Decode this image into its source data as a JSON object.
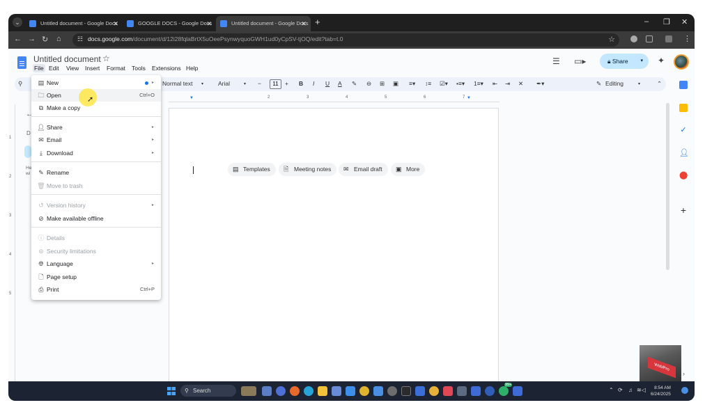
{
  "browser": {
    "tabs": [
      {
        "title": "Untitled document - Google Docs",
        "active": false
      },
      {
        "title": "GOOGLE DOCS - Google Docs",
        "active": false
      },
      {
        "title": "Untitled document - Google Docs",
        "active": true
      }
    ],
    "url_host": "docs.google.com",
    "url_path": "/document/d/12i28fqlaBrtX5uOeePsynwyquoGWH1ud0yCpSV-tjOQ/edit?tab=t.0"
  },
  "docs": {
    "title": "Untitled document",
    "menubar": [
      "File",
      "Edit",
      "View",
      "Insert",
      "Format",
      "Tools",
      "Extensions",
      "Help"
    ],
    "share_label": "Share",
    "toolbar": {
      "style": "Normal text",
      "font": "Arial",
      "font_size": "11",
      "mode": "Editing"
    },
    "ruler_numbers": [
      "1",
      "2",
      "3",
      "4",
      "5",
      "6",
      "7"
    ],
    "vruler_numbers": [
      "1",
      "2",
      "3",
      "4",
      "5"
    ],
    "chips": [
      {
        "label": "Templates",
        "icon": "templates-icon"
      },
      {
        "label": "Meeting notes",
        "icon": "meeting-notes-icon"
      },
      {
        "label": "Email draft",
        "icon": "email-draft-icon"
      },
      {
        "label": "More",
        "icon": "more-icon"
      }
    ],
    "outline_fragments": [
      "D",
      "He",
      "wi"
    ]
  },
  "file_menu": {
    "items": [
      {
        "label": "New",
        "icon": "new-doc-icon",
        "shortcut": "",
        "submenu": true,
        "disabled": false,
        "badge_dot": true
      },
      {
        "label": "Open",
        "icon": "folder-icon",
        "shortcut": "Ctrl+O",
        "submenu": false,
        "disabled": false,
        "hover": true
      },
      {
        "label": "Make a copy",
        "icon": "copy-icon",
        "shortcut": "",
        "submenu": false,
        "disabled": false
      },
      {
        "label": "Share",
        "icon": "share-person-icon",
        "shortcut": "",
        "submenu": true,
        "disabled": false
      },
      {
        "label": "Email",
        "icon": "email-icon",
        "shortcut": "",
        "submenu": true,
        "disabled": false
      },
      {
        "label": "Download",
        "icon": "download-icon",
        "shortcut": "",
        "submenu": true,
        "disabled": false
      },
      {
        "label": "Rename",
        "icon": "pencil-icon",
        "shortcut": "",
        "submenu": false,
        "disabled": false
      },
      {
        "label": "Move to trash",
        "icon": "trash-icon",
        "shortcut": "",
        "submenu": false,
        "disabled": true
      },
      {
        "label": "Version history",
        "icon": "history-icon",
        "shortcut": "",
        "submenu": true,
        "disabled": true
      },
      {
        "label": "Make available offline",
        "icon": "offline-icon",
        "shortcut": "",
        "submenu": false,
        "disabled": false
      },
      {
        "label": "Details",
        "icon": "info-icon",
        "shortcut": "",
        "submenu": false,
        "disabled": true
      },
      {
        "label": "Security limitations",
        "icon": "security-icon",
        "shortcut": "",
        "submenu": false,
        "disabled": true
      },
      {
        "label": "Language",
        "icon": "globe-icon",
        "shortcut": "",
        "submenu": true,
        "disabled": false
      },
      {
        "label": "Page setup",
        "icon": "page-setup-icon",
        "shortcut": "",
        "submenu": false,
        "disabled": false
      },
      {
        "label": "Print",
        "icon": "printer-icon",
        "shortcut": "Ctrl+P",
        "submenu": false,
        "disabled": false
      }
    ]
  },
  "taskbar": {
    "search_label": "Search",
    "time": "8:54 AM",
    "date": "6/24/2025",
    "badge": "99+"
  },
  "webcam": {
    "key_label": "WebPro"
  },
  "colors": {
    "brand_blue": "#4285f4",
    "share_bg": "#c2e7ff",
    "toolbar_bg": "#edf2fa",
    "taskbar_bg": "#1c2333"
  }
}
